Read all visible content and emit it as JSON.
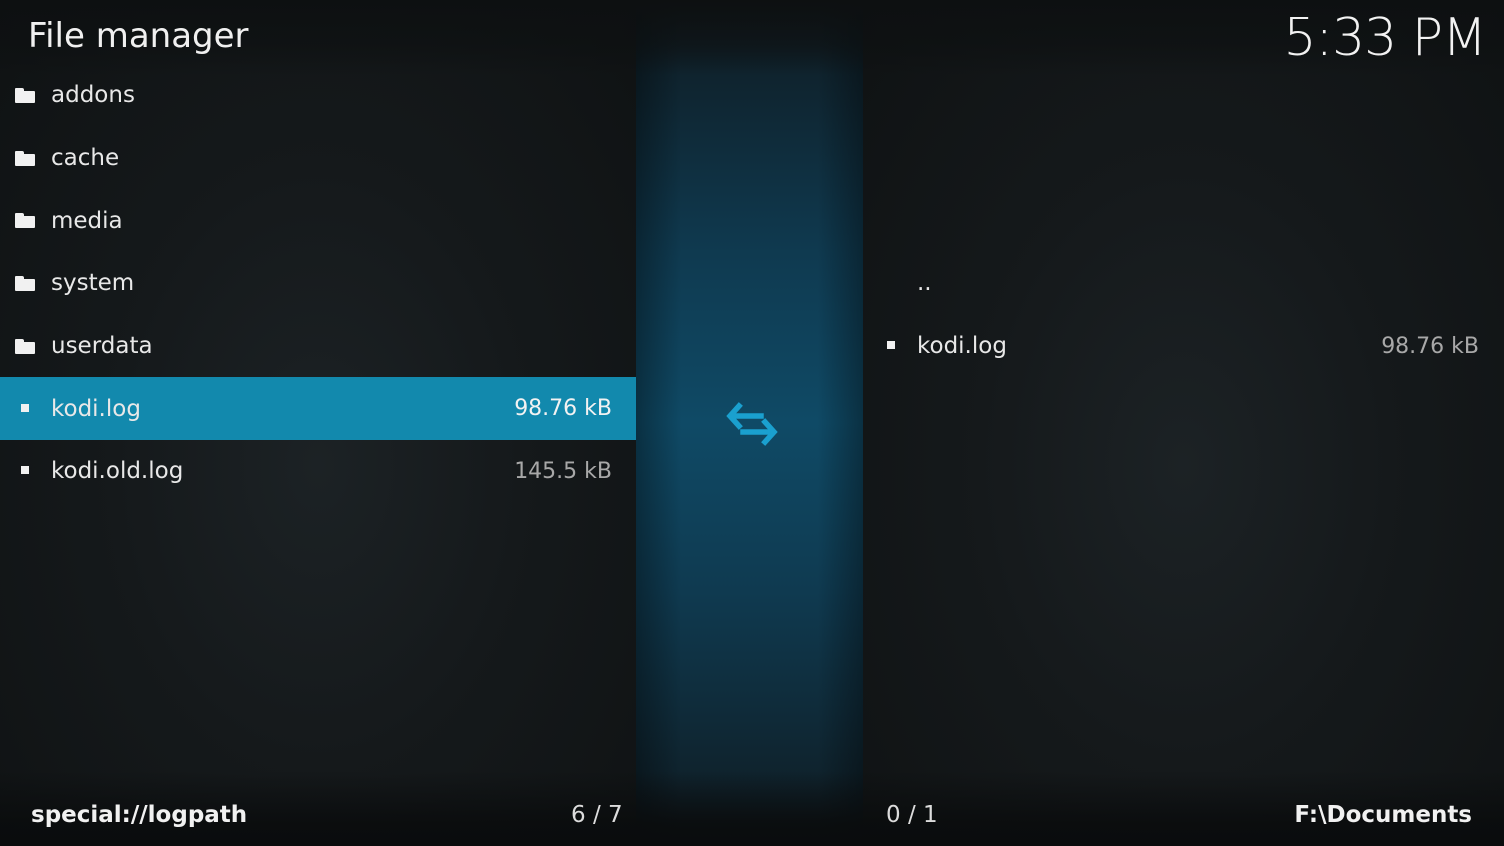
{
  "header": {
    "title": "File manager",
    "clock": "5:33 PM"
  },
  "left_pane": {
    "items": [
      {
        "type": "folder",
        "icon": "folder-icon",
        "name": "addons",
        "size": ""
      },
      {
        "type": "folder",
        "icon": "folder-icon",
        "name": "cache",
        "size": ""
      },
      {
        "type": "folder",
        "icon": "folder-icon",
        "name": "media",
        "size": ""
      },
      {
        "type": "folder",
        "icon": "folder-icon",
        "name": "system",
        "size": ""
      },
      {
        "type": "folder",
        "icon": "folder-icon",
        "name": "userdata",
        "size": ""
      },
      {
        "type": "file",
        "icon": "file-icon",
        "name": "kodi.log",
        "size": "98.76 kB",
        "selected": true
      },
      {
        "type": "file",
        "icon": "file-icon",
        "name": "kodi.old.log",
        "size": "145.5 kB"
      }
    ],
    "path": "special://logpath",
    "count": "6 / 7"
  },
  "right_pane": {
    "items": [
      {
        "type": "parent",
        "icon": "",
        "name": "..",
        "size": ""
      },
      {
        "type": "file",
        "icon": "file-icon",
        "name": "kodi.log",
        "size": "98.76 kB"
      }
    ],
    "path": "F:\\Documents",
    "count": "0 / 1"
  },
  "center": {
    "icon": "swap-arrows-icon"
  },
  "colors": {
    "accent": "#1289ad",
    "swap_icon": "#1aa0cf",
    "background": "#111416"
  }
}
